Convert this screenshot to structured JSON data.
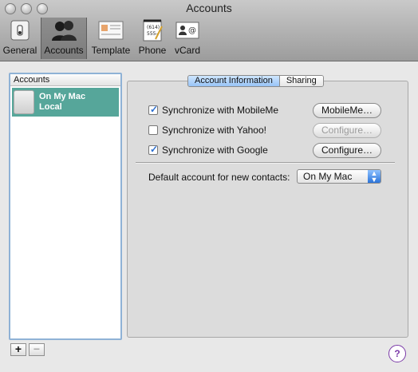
{
  "window": {
    "title": "Accounts"
  },
  "toolbar": {
    "items": [
      {
        "label": "General",
        "icon": "switch-icon"
      },
      {
        "label": "Accounts",
        "icon": "people-icon",
        "selected": true
      },
      {
        "label": "Template",
        "icon": "template-icon"
      },
      {
        "label": "Phone",
        "icon": "phone-notepad-icon"
      },
      {
        "label": "vCard",
        "icon": "vcard-icon"
      }
    ]
  },
  "accounts_list": {
    "header": "Accounts",
    "items": [
      {
        "name": "On My Mac",
        "subtitle": "Local"
      }
    ]
  },
  "tabs": {
    "account_information": "Account Information",
    "sharing": "Sharing"
  },
  "sync": {
    "mobileme_label": "Synchronize with MobileMe",
    "mobileme_checked": true,
    "mobileme_button": "MobileMe…",
    "yahoo_label": "Synchronize with Yahoo!",
    "yahoo_checked": false,
    "yahoo_button": "Configure…",
    "google_label": "Synchronize with Google",
    "google_checked": true,
    "google_button": "Configure…"
  },
  "default_account": {
    "label": "Default account for new contacts:",
    "value": "On My Mac"
  },
  "bottom": {
    "add": "+",
    "remove": "−",
    "help": "?"
  },
  "colors": {
    "selection": "#56a69a",
    "focus_ring": "#8fb2d6",
    "tab_active": "#8fbef5",
    "help": "#7b3aa8"
  }
}
